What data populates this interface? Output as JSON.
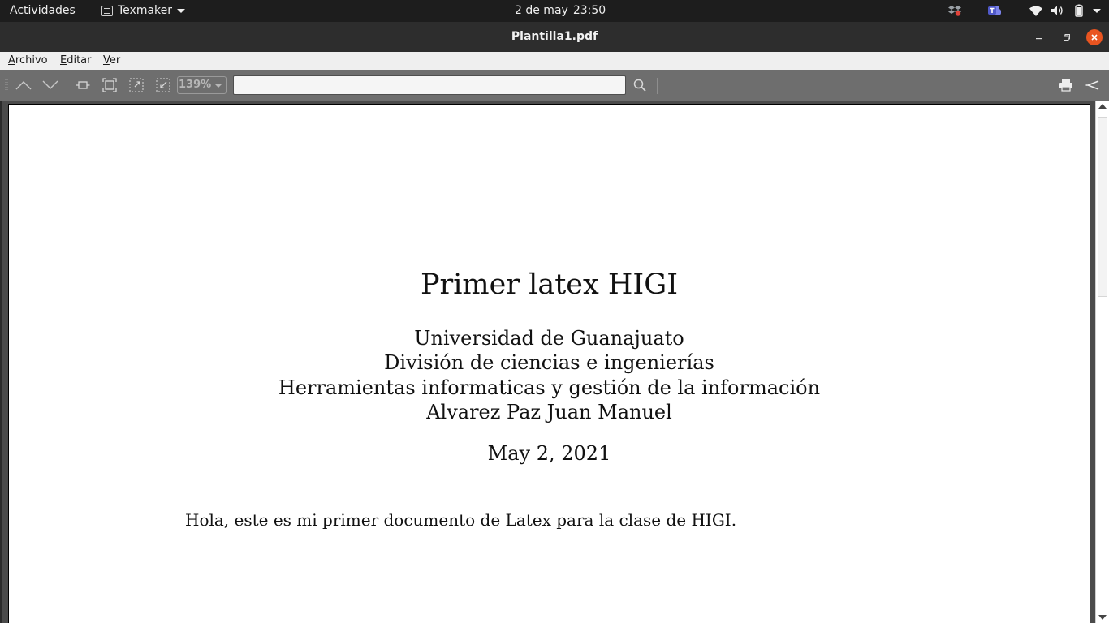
{
  "topbar": {
    "activities": "Actividades",
    "app_name": "Texmaker",
    "date": "2 de may",
    "time": "23:50",
    "tray_icons": [
      "dropbox-icon",
      "teams-icon",
      "wifi-icon",
      "volume-icon",
      "battery-icon",
      "system-menu-caret-icon"
    ]
  },
  "window": {
    "title": "Plantilla1.pdf"
  },
  "menu": {
    "archivo": "Archivo",
    "editar": "Editar",
    "ver": "Ver"
  },
  "toolbar": {
    "zoom": "139%",
    "search_value": "",
    "icons": [
      "previous-page-icon",
      "next-page-icon",
      "fit-width-icon",
      "fit-page-icon",
      "zoom-in-icon",
      "zoom-out-icon",
      "search-icon",
      "print-icon",
      "external-viewer-icon"
    ]
  },
  "document": {
    "title": "Primer latex HIGI",
    "authors": [
      "Universidad de Guanajuato",
      "División de ciencias e ingenierías",
      "Herramientas informaticas y gestión de la información",
      "Alvarez Paz Juan Manuel"
    ],
    "date": "May 2, 2021",
    "body": "Hola, este es mi primer documento de Latex para la clase de HIGI."
  },
  "colors": {
    "topbar_bg": "#1d1d1d",
    "titlebar_bg": "#2d2d2d",
    "close_button": "#e95420",
    "toolbar_bg": "#6e6e6e",
    "page_bg": "#ffffff"
  }
}
